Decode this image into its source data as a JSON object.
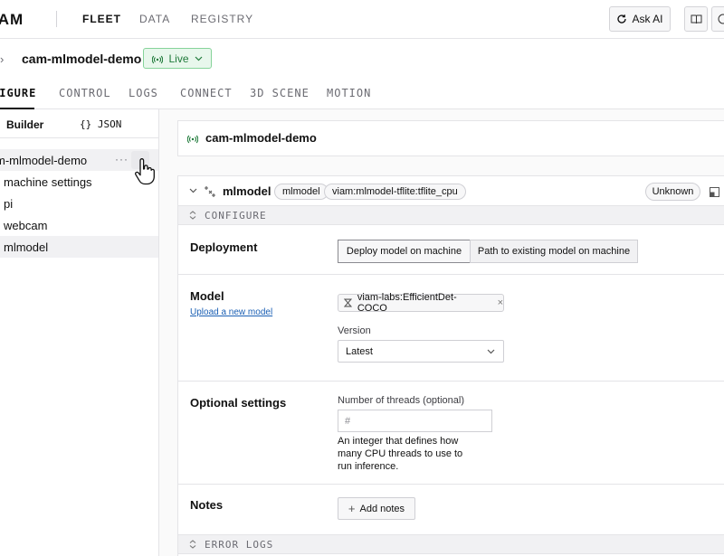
{
  "topnav": {
    "logo": "IAM",
    "links": [
      "FLEET",
      "DATA",
      "REGISTRY"
    ],
    "ask_ai": "Ask AI"
  },
  "breadcrumb": {
    "machine": "cam-mlmodel-demo",
    "status": "Live"
  },
  "tabs": [
    "FIGURE",
    "CONTROL",
    "LOGS",
    "CONNECT",
    "3D SCENE",
    "MOTION"
  ],
  "left_panel": {
    "mode_tabs": [
      "Builder",
      "{} JSON"
    ],
    "tree": [
      {
        "label": "m-mlmodel-demo"
      },
      {
        "label": "machine settings"
      },
      {
        "label": "pi"
      },
      {
        "label": "webcam"
      },
      {
        "label": "mlmodel"
      }
    ],
    "more_glyph": "···"
  },
  "machine_card": {
    "title": "cam-mlmodel-demo"
  },
  "service": {
    "name": "mlmodel",
    "api": "mlmodel",
    "model": "viam:mlmodel-tflite:tflite_cpu",
    "status": "Unknown",
    "configure_label": "CONFIGURE",
    "deployment": {
      "label": "Deployment",
      "options": [
        "Deploy model on machine",
        "Path to existing model on machine"
      ],
      "selected": "Deploy model on machine"
    },
    "model_row": {
      "label": "Model",
      "upload_link": "Upload a new model",
      "chip": "viam-labs:EfficientDet-COCO",
      "version_label": "Version",
      "version_value": "Latest"
    },
    "optional": {
      "label": "Optional settings",
      "threads_label": "Number of threads (optional)",
      "threads_placeholder": "#",
      "threads_help": "An integer that defines how many CPU threads to use to run inference."
    },
    "notes": {
      "label": "Notes",
      "button": "Add notes"
    },
    "error_logs_label": "ERROR LOGS"
  }
}
